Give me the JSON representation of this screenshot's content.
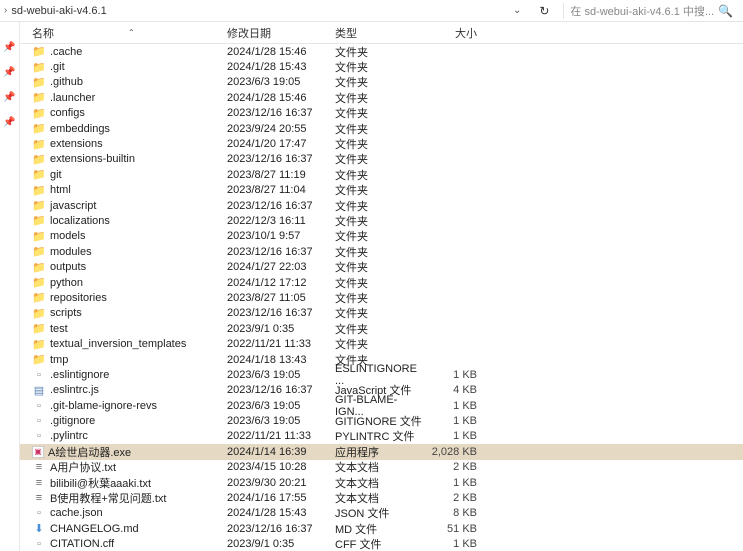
{
  "toolbar": {
    "path": "sd-webui-aki-v4.6.1",
    "search_placeholder": "在 sd-webui-aki-v4.6.1 中搜..."
  },
  "headers": {
    "name": "名称",
    "date": "修改日期",
    "type": "类型",
    "size": "大小"
  },
  "rows": [
    {
      "icon": "folder",
      "name": ".cache",
      "date": "2024/1/28 15:46",
      "type": "文件夹",
      "size": ""
    },
    {
      "icon": "folder",
      "name": ".git",
      "date": "2024/1/28 15:43",
      "type": "文件夹",
      "size": ""
    },
    {
      "icon": "folder",
      "name": ".github",
      "date": "2023/6/3 19:05",
      "type": "文件夹",
      "size": ""
    },
    {
      "icon": "folder",
      "name": ".launcher",
      "date": "2024/1/28 15:46",
      "type": "文件夹",
      "size": ""
    },
    {
      "icon": "folder",
      "name": "configs",
      "date": "2023/12/16 16:37",
      "type": "文件夹",
      "size": ""
    },
    {
      "icon": "folder",
      "name": "embeddings",
      "date": "2023/9/24 20:55",
      "type": "文件夹",
      "size": ""
    },
    {
      "icon": "folder",
      "name": "extensions",
      "date": "2024/1/20 17:47",
      "type": "文件夹",
      "size": ""
    },
    {
      "icon": "folder",
      "name": "extensions-builtin",
      "date": "2023/12/16 16:37",
      "type": "文件夹",
      "size": ""
    },
    {
      "icon": "folder",
      "name": "git",
      "date": "2023/8/27 11:19",
      "type": "文件夹",
      "size": ""
    },
    {
      "icon": "folder",
      "name": "html",
      "date": "2023/8/27 11:04",
      "type": "文件夹",
      "size": ""
    },
    {
      "icon": "folder",
      "name": "javascript",
      "date": "2023/12/16 16:37",
      "type": "文件夹",
      "size": ""
    },
    {
      "icon": "folder",
      "name": "localizations",
      "date": "2022/12/3 16:11",
      "type": "文件夹",
      "size": ""
    },
    {
      "icon": "folder",
      "name": "models",
      "date": "2023/10/1 9:57",
      "type": "文件夹",
      "size": ""
    },
    {
      "icon": "folder",
      "name": "modules",
      "date": "2023/12/16 16:37",
      "type": "文件夹",
      "size": ""
    },
    {
      "icon": "folder",
      "name": "outputs",
      "date": "2024/1/27 22:03",
      "type": "文件夹",
      "size": ""
    },
    {
      "icon": "folder",
      "name": "python",
      "date": "2024/1/12 17:12",
      "type": "文件夹",
      "size": ""
    },
    {
      "icon": "folder",
      "name": "repositories",
      "date": "2023/8/27 11:05",
      "type": "文件夹",
      "size": ""
    },
    {
      "icon": "folder",
      "name": "scripts",
      "date": "2023/12/16 16:37",
      "type": "文件夹",
      "size": ""
    },
    {
      "icon": "folder",
      "name": "test",
      "date": "2023/9/1 0:35",
      "type": "文件夹",
      "size": ""
    },
    {
      "icon": "folder",
      "name": "textual_inversion_templates",
      "date": "2022/11/21 11:33",
      "type": "文件夹",
      "size": ""
    },
    {
      "icon": "folder",
      "name": "tmp",
      "date": "2024/1/18 13:43",
      "type": "文件夹",
      "size": ""
    },
    {
      "icon": "file",
      "name": ".eslintignore",
      "date": "2023/6/3 19:05",
      "type": "ESLINTIGNORE ...",
      "size": "1 KB"
    },
    {
      "icon": "js",
      "name": ".eslintrc.js",
      "date": "2023/12/16 16:37",
      "type": "JavaScript 文件",
      "size": "4 KB"
    },
    {
      "icon": "file",
      "name": ".git-blame-ignore-revs",
      "date": "2023/6/3 19:05",
      "type": "GIT-BLAME-IGN...",
      "size": "1 KB"
    },
    {
      "icon": "file",
      "name": ".gitignore",
      "date": "2023/6/3 19:05",
      "type": "GITIGNORE 文件",
      "size": "1 KB"
    },
    {
      "icon": "file",
      "name": ".pylintrc",
      "date": "2022/11/21 11:33",
      "type": "PYLINTRC 文件",
      "size": "1 KB"
    },
    {
      "icon": "exe",
      "name": "A绘世启动器.exe",
      "date": "2024/1/14 16:39",
      "type": "应用程序",
      "size": "2,028 KB",
      "selected": true
    },
    {
      "icon": "txt",
      "name": "A用户协议.txt",
      "date": "2023/4/15 10:28",
      "type": "文本文档",
      "size": "2 KB"
    },
    {
      "icon": "txt",
      "name": "bilibili@秋葉aaaki.txt",
      "date": "2023/9/30 20:21",
      "type": "文本文档",
      "size": "1 KB"
    },
    {
      "icon": "txt",
      "name": "B使用教程+常见问题.txt",
      "date": "2024/1/16 17:55",
      "type": "文本文档",
      "size": "2 KB"
    },
    {
      "icon": "json",
      "name": "cache.json",
      "date": "2024/1/28 15:43",
      "type": "JSON 文件",
      "size": "8 KB"
    },
    {
      "icon": "md",
      "name": "CHANGELOG.md",
      "date": "2023/12/16 16:37",
      "type": "MD 文件",
      "size": "51 KB"
    },
    {
      "icon": "cff",
      "name": "CITATION.cff",
      "date": "2023/9/1 0:35",
      "type": "CFF 文件",
      "size": "1 KB"
    }
  ]
}
